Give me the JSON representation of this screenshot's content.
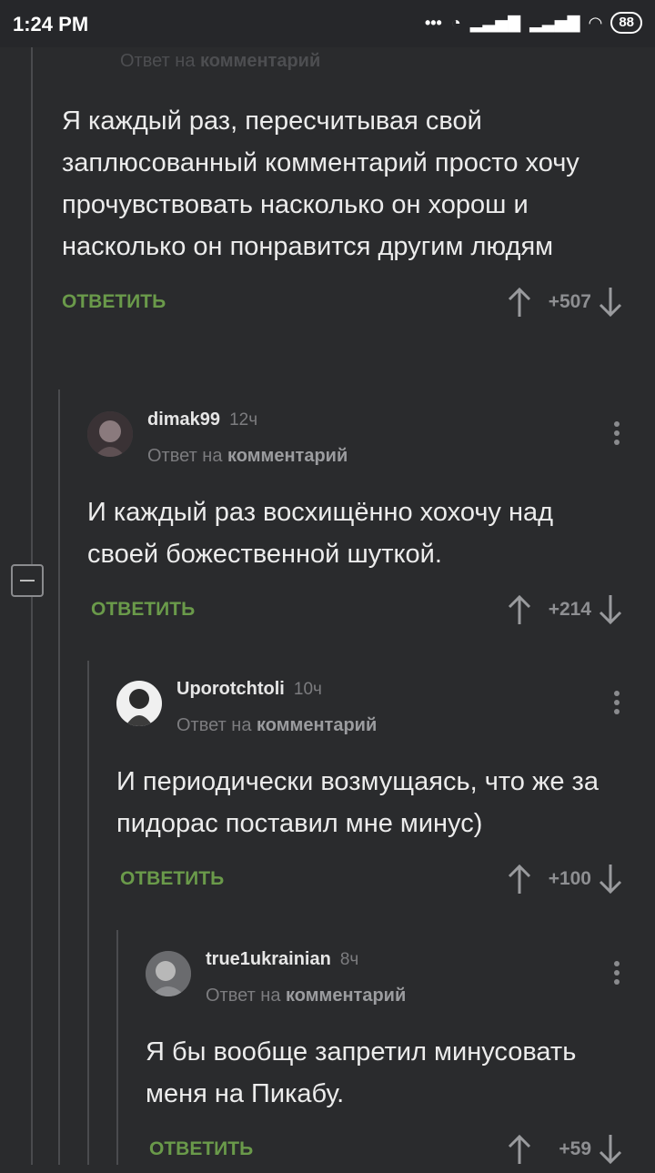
{
  "status": {
    "time": "1:24 PM",
    "battery": "88"
  },
  "top_fade": {
    "reply_prefix": "Ответ на",
    "reply_target": "комментарий"
  },
  "comments": [
    {
      "text": "Я каждый раз, пересчитывая свой заплюсованный комментарий просто хочу прочувствовать насколько он хорош и насколько он понравится другим людям",
      "reply_label": "ОТВЕТИТЬ",
      "score": "+507"
    },
    {
      "author": "dimak99",
      "age": "12ч",
      "reply_prefix": "Ответ на",
      "reply_target": "комментарий",
      "text": "И каждый раз восхищённо хохочу над своей божественной шуткой.",
      "reply_label": "ОТВЕТИТЬ",
      "score": "+214"
    },
    {
      "author": "Uporotchtoli",
      "age": "10ч",
      "reply_prefix": "Ответ на",
      "reply_target": "комментарий",
      "text": "И периодически возмущаясь, что же за пидорас поставил мне минус)",
      "reply_label": "ОТВЕТИТЬ",
      "score": "+100"
    },
    {
      "author": "true1ukrainian",
      "age": "8ч",
      "reply_prefix": "Ответ на",
      "reply_target": "комментарий",
      "text": "Я бы вообще запретил минусовать меня на Пикабу.",
      "reply_label": "ОТВЕТИТЬ",
      "score": "+59"
    }
  ],
  "colors": {
    "background": "#2a2b2d",
    "reply_green": "#6a9a4a",
    "muted": "#7c7c7f"
  }
}
